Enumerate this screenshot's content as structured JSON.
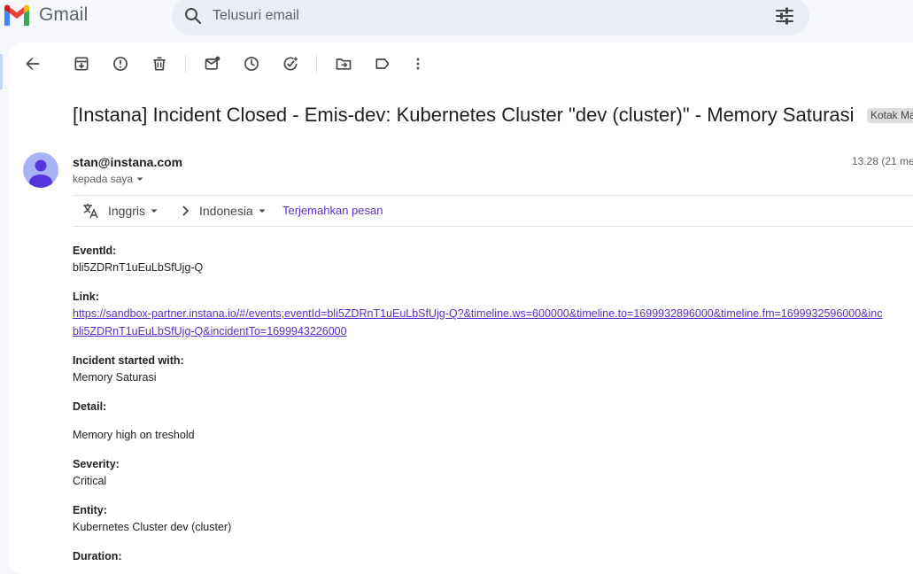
{
  "app": {
    "name": "Gmail"
  },
  "colors": {
    "brand_red": "#ea4335",
    "brand_blue": "#4285f4",
    "brand_green": "#34a853",
    "brand_yellow": "#fbbc04",
    "link": "#5b2dca",
    "search_bg": "#e9eef6",
    "avatar": "#a8b2f5"
  },
  "search": {
    "placeholder": "Telusuri email",
    "value": ""
  },
  "toolbar": {
    "icons": [
      "back-icon",
      "archive-icon",
      "report-spam-icon",
      "delete-icon",
      "mark-unread-icon",
      "snooze-icon",
      "add-to-tasks-icon",
      "move-to-icon",
      "label-icon",
      "more-icon"
    ]
  },
  "message": {
    "subject": "[Instana] Incident Closed - Emis-dev: Kubernetes Cluster \"dev (cluster)\" - Memory Saturasi",
    "label": "Kotak Ma",
    "sender": "stan@instana.com",
    "to_line": "kepada saya",
    "time": "13.28 (21 mer"
  },
  "translate": {
    "from": "Inggris",
    "to": "Indonesia",
    "action": "Terjemahkan pesan"
  },
  "body": {
    "event_id_label": "EventId:",
    "event_id_value": "bli5ZDRnT1uEuLbSfUjg-Q",
    "link_label": "Link:",
    "link_line1": "https://sandbox-partner.instana.io/#/events;eventId=bli5ZDRnT1uEuLbSfUjg-Q?&timeline.ws=600000&timeline.to=1699932896000&timeline.fm=1699932596000&inc",
    "link_line2": "bli5ZDRnT1uEuLbSfUjg-Q&incidentTo=1699943226000",
    "started_label": "Incident started with:",
    "started_value": "Memory Saturasi",
    "detail_label": "Detail:",
    "detail_value": "Memory high on treshold",
    "severity_label": "Severity:",
    "severity_value": "Critical",
    "entity_label": "Entity:",
    "entity_value": "Kubernetes Cluster dev (cluster)",
    "duration_label": "Duration:"
  }
}
